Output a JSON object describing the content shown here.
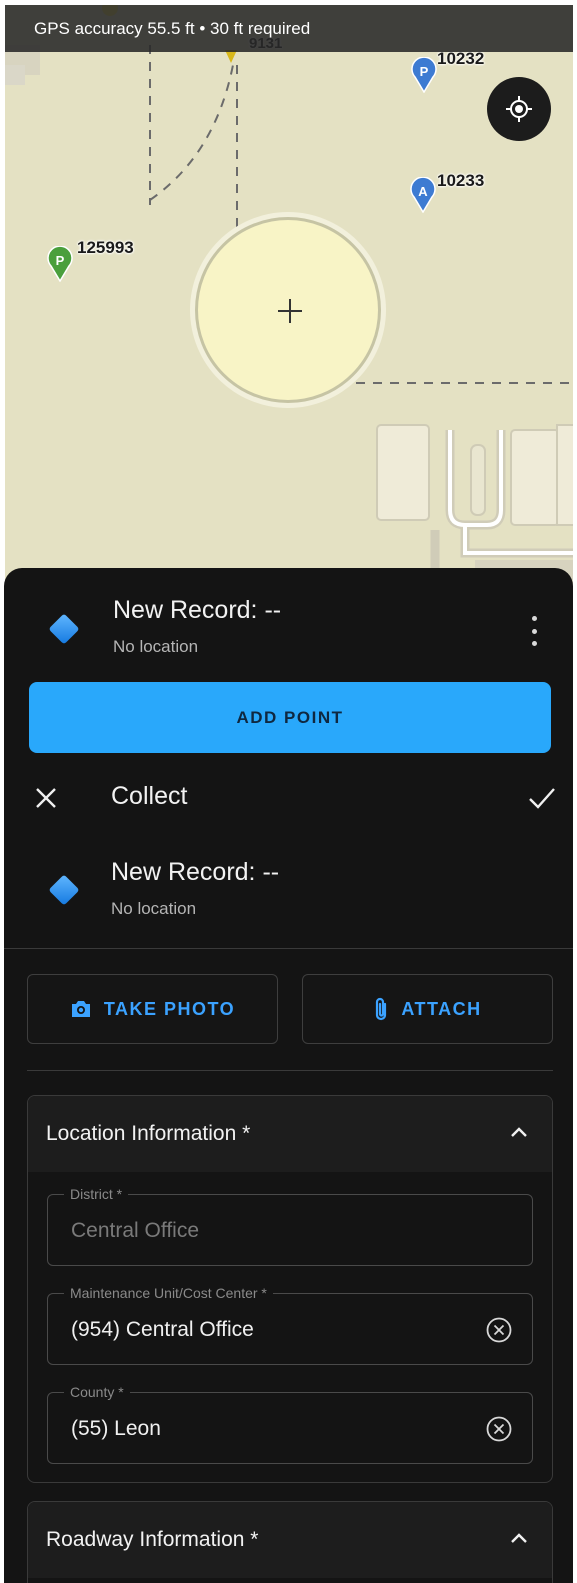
{
  "map": {
    "gps_status": "GPS accuracy 55.5 ft  •  30 ft required",
    "markers": [
      {
        "letter": "P",
        "label": "10232",
        "color": "#3d7bd2"
      },
      {
        "letter": "A",
        "label": "10233",
        "color": "#3d7bd2"
      },
      {
        "letter": "P",
        "label": "125993",
        "color": "#4a9f3c"
      },
      {
        "label": "9131"
      }
    ],
    "locate_icon": "my-location-icon",
    "crosshair": "+"
  },
  "sheet": {
    "record_title": "New Record: --",
    "record_subtitle": "No location",
    "add_point_label": "ADD POINT",
    "accent": "#29a8fb"
  },
  "collect": {
    "title": "Collect",
    "record_title": "New Record: --",
    "record_subtitle": "No location",
    "take_photo_label": "TAKE PHOTO",
    "attach_label": "ATTACH",
    "location_section": {
      "title": "Location Information *",
      "fields": [
        {
          "label": "District *",
          "value": "Central Office",
          "disabled": true
        },
        {
          "label": "Maintenance Unit/Cost Center *",
          "value": "(954) Central Office"
        },
        {
          "label": "County *",
          "value": "(55) Leon"
        }
      ]
    },
    "roadway_section": {
      "title": "Roadway Information *"
    }
  }
}
